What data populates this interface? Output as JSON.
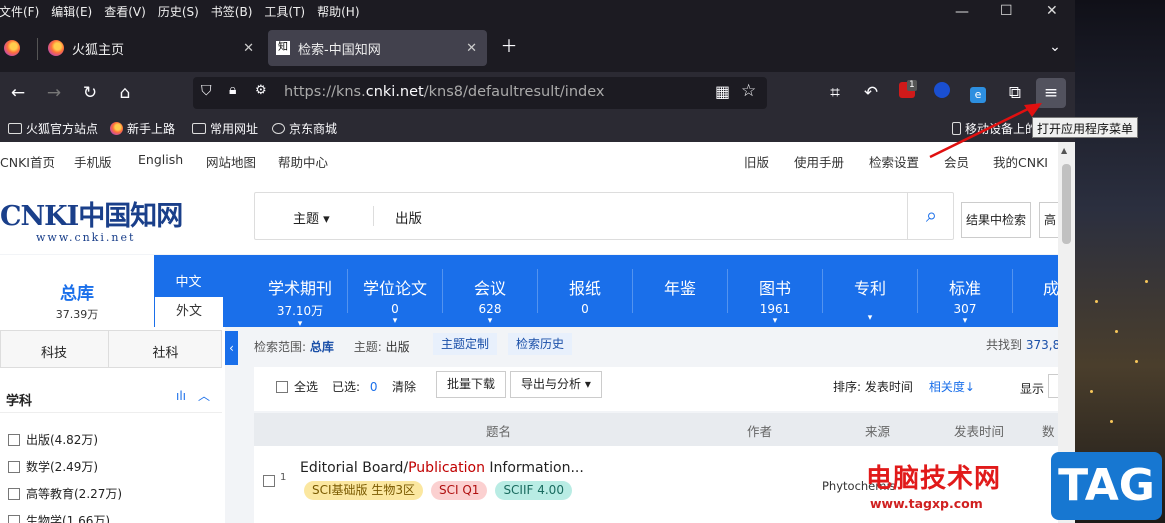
{
  "menubar": {
    "items": [
      "文件(F)",
      "编辑(E)",
      "查看(V)",
      "历史(S)",
      "书签(B)",
      "工具(T)",
      "帮助(H)"
    ]
  },
  "tabs": [
    {
      "label": "火狐主页"
    },
    {
      "label": "检索-中国知网"
    }
  ],
  "url": {
    "prefix": "https://kns.",
    "domain": "cnki.net",
    "path": "/kns8/defaultresult/index"
  },
  "extension_badge": "1",
  "bookmarks": [
    "火狐官方站点",
    "新手上路",
    "常用网址",
    "京东商城",
    "移动设备上的书签"
  ],
  "tooltip": "打开应用程序菜单",
  "site_nav": {
    "left": [
      "CNKI首页",
      "手机版",
      "English",
      "网站地图",
      "帮助中心"
    ],
    "right": [
      "旧版",
      "使用手册",
      "检索设置",
      "会员",
      "我的CNKI"
    ]
  },
  "logo": {
    "text": "CNKI中国知网",
    "url": "www.cnki.net"
  },
  "search": {
    "field": "主题",
    "value": "出版",
    "in_results": "结果中检索",
    "advanced": "高"
  },
  "db_tabs": {
    "main": {
      "name": "总库",
      "count": "37.39万"
    },
    "chinese": "中文",
    "foreign": "外文",
    "categories": [
      {
        "name": "学术期刊",
        "count": "37.10万"
      },
      {
        "name": "学位论文",
        "count": "0"
      },
      {
        "name": "会议",
        "count": "628"
      },
      {
        "name": "报纸",
        "count": "0"
      },
      {
        "name": "年鉴",
        "count": ""
      },
      {
        "name": "图书",
        "count": "1961"
      },
      {
        "name": "专利",
        "count": ""
      },
      {
        "name": "标准",
        "count": "307"
      },
      {
        "name": "成",
        "count": ""
      }
    ]
  },
  "side_tabs": [
    "科技",
    "社科"
  ],
  "facet": {
    "title": "学科",
    "items": [
      "出版(4.82万)",
      "数学(2.49万)",
      "高等教育(2.27万)",
      "生物学(1.66万)"
    ]
  },
  "scope": {
    "label": "检索范围:",
    "db": "总库",
    "topic_label": "主题:",
    "topic": "出版",
    "custom": "主题定制",
    "history": "检索历史",
    "found": "共找到",
    "found_count": "373,8"
  },
  "toolbar": {
    "select_all": "全选",
    "selected_label": "已选:",
    "selected_count": "0",
    "clear": "清除",
    "batch_download": "批量下载",
    "export": "导出与分析",
    "sort_label": "排序:",
    "sort_date": "发表时间",
    "sort_relevance": "相关度",
    "display": "显示"
  },
  "table": {
    "headers": [
      "题名",
      "作者",
      "来源",
      "发表时间",
      "数"
    ]
  },
  "row": {
    "num": "1",
    "title_a": "Editorial Board/",
    "title_hl": "Publication",
    "title_b": " Information...",
    "source": "Phytochemis",
    "tags": [
      "SCI基础版 生物3区",
      "SCI Q1",
      "SCIIF 4.00"
    ]
  },
  "watermark": {
    "text": "电脑技术网",
    "url": "www.tagxp.com",
    "tag": "TAG"
  },
  "colors": {
    "accent": "#1a6fea",
    "highlight": "#c00000"
  }
}
